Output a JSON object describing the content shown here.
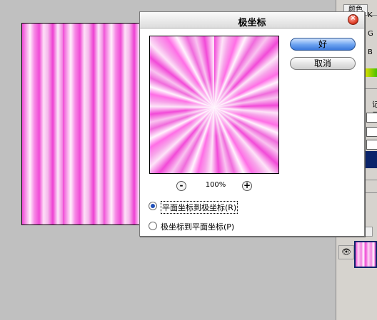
{
  "dialog": {
    "title": "极坐标",
    "ok_label": "好",
    "cancel_label": "取消",
    "zoom_out_label": "-",
    "zoom_in_label": "+",
    "zoom_level": "100%",
    "options": [
      {
        "label": "平面坐标到极坐标(R)",
        "selected": true
      },
      {
        "label": "极坐标到平面坐标(P)",
        "selected": false
      }
    ]
  },
  "right_panel": {
    "tab_label": "颜色",
    "letters": [
      "K",
      "G",
      "B"
    ],
    "history_label": "记录",
    "layer_visibility_icon": "eye-icon"
  },
  "colors": {
    "accent_ok": "#3a78da",
    "canvas_pink": "#f04ad6",
    "close_red": "#e0402a"
  }
}
